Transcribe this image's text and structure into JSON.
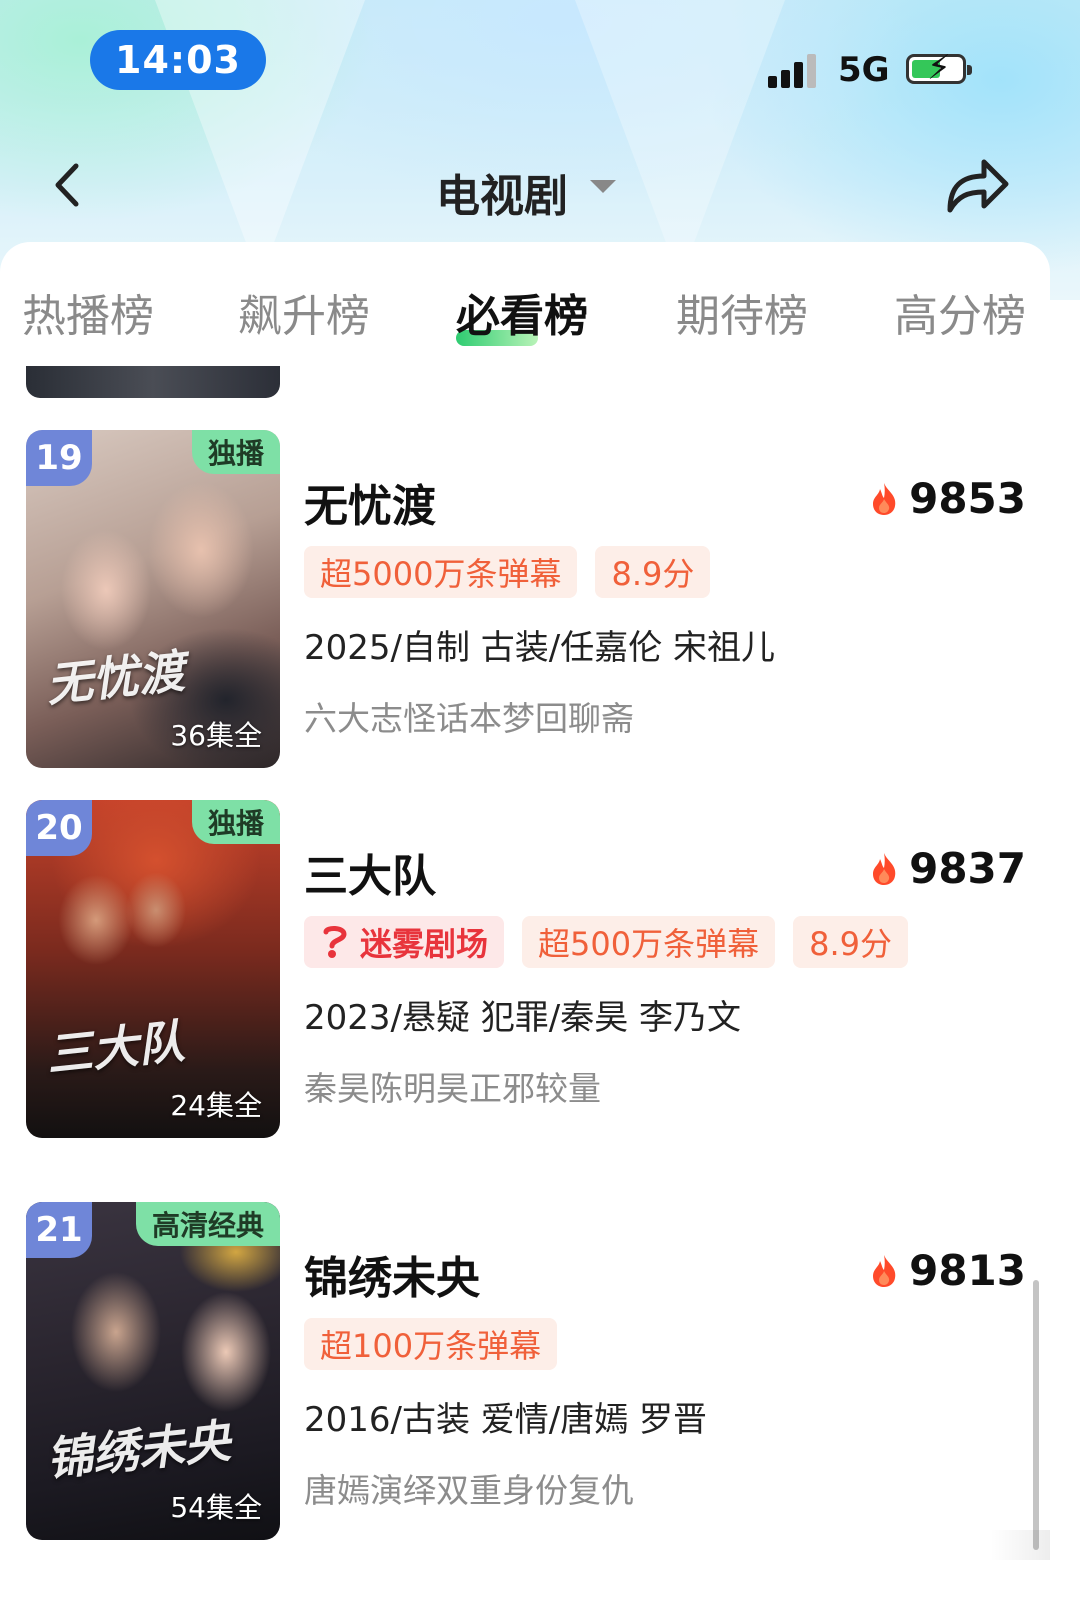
{
  "status_bar": {
    "time": "14:03",
    "network": "5G"
  },
  "nav": {
    "title": "电视剧"
  },
  "tabs": [
    {
      "label": "热播榜",
      "active": false
    },
    {
      "label": "飙升榜",
      "active": false
    },
    {
      "label": "必看榜",
      "active": true
    },
    {
      "label": "期待榜",
      "active": false
    },
    {
      "label": "高分榜",
      "active": false
    }
  ],
  "items": [
    {
      "rank": "19",
      "flag": "独播",
      "poster_title": "无忧渡",
      "episodes": "36集全",
      "title": "无忧渡",
      "heat": "9853",
      "tags": [
        "超5000万条弹幕",
        "8.9分"
      ],
      "meta": "2025/自制 古装/任嘉伦 宋祖儿",
      "desc": "六大志怪话本梦回聊斋"
    },
    {
      "rank": "20",
      "flag": "独播",
      "poster_title": "三大队",
      "episodes": "24集全",
      "title": "三大队",
      "heat": "9837",
      "brand_tag": "迷雾剧场",
      "tags": [
        "超500万条弹幕",
        "8.9分"
      ],
      "meta": "2023/悬疑 犯罪/秦昊 李乃文",
      "desc": "秦昊陈明昊正邪较量"
    },
    {
      "rank": "21",
      "flag": "高清经典",
      "poster_title": "锦绣未央",
      "episodes": "54集全",
      "title": "锦绣未央",
      "heat": "9813",
      "tags": [
        "超100万条弹幕"
      ],
      "meta": "2016/古装 爱情/唐嫣 罗晋",
      "desc": "唐嫣演绎双重身份复仇"
    }
  ],
  "colors": {
    "accent_green": "#2ecc71",
    "tag_text": "#f0603a",
    "tag_bg": "#fdeee8",
    "rank_badge": "#6f86d8",
    "flag_badge": "#7ee0a6",
    "time_pill": "#1a78e8"
  },
  "icons": [
    "back-icon",
    "caret-down-icon",
    "share-icon",
    "flame-icon",
    "signal-icon",
    "battery-icon",
    "brand-logo-icon"
  ]
}
